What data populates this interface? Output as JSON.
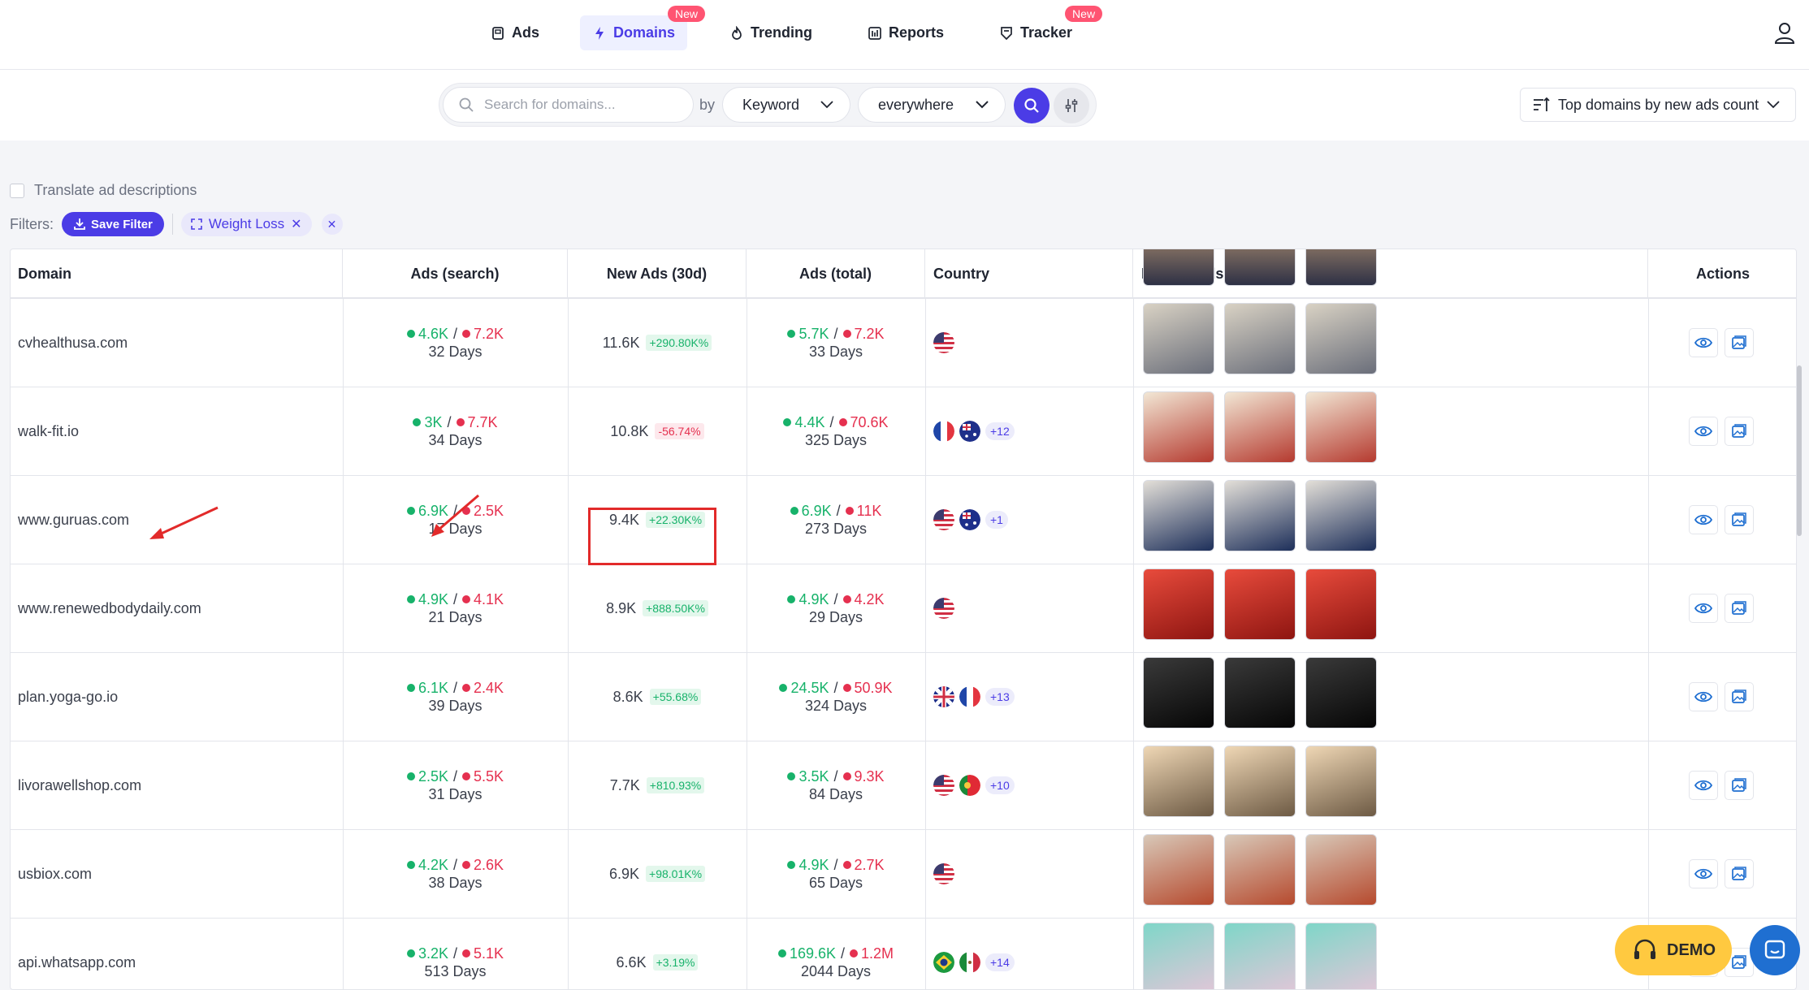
{
  "nav": {
    "items": [
      {
        "label": "Ads",
        "icon": "ads-icon",
        "active": false,
        "badge": ""
      },
      {
        "label": "Domains",
        "icon": "bolt-icon",
        "active": true,
        "badge": "New"
      },
      {
        "label": "Trending",
        "icon": "flame-icon",
        "active": false,
        "badge": ""
      },
      {
        "label": "Reports",
        "icon": "reports-icon",
        "active": false,
        "badge": ""
      },
      {
        "label": "Tracker",
        "icon": "tracker-icon",
        "active": false,
        "badge": "New"
      }
    ]
  },
  "search": {
    "placeholder": "Search for domains...",
    "by_label": "by",
    "field_select": "Keyword",
    "scope_select": "everywhere",
    "sort_label": "Top domains by new ads count"
  },
  "translate_label": "Translate ad descriptions",
  "filters": {
    "label": "Filters:",
    "save_label": "Save Filter",
    "chips": [
      {
        "label": "Weight Loss"
      }
    ]
  },
  "table": {
    "headers": {
      "domain": "Domain",
      "ads_search": "Ads (search)",
      "new_ads": "New Ads (30d)",
      "ads_total": "Ads (total)",
      "country": "Country",
      "newest_ads": "Newest Ads",
      "actions": "Actions"
    },
    "rows": [
      {
        "domain": "cvhealthusa.com",
        "search_active": "4.6K",
        "search_inactive": "7.2K",
        "search_days": "32 Days",
        "new_ads": "11.6K",
        "change": "+290.80K%",
        "total_active": "5.7K",
        "total_inactive": "7.2K",
        "total_days": "33 Days",
        "flags": [
          "us"
        ],
        "more": ""
      },
      {
        "domain": "walk-fit.io",
        "search_active": "3K",
        "search_inactive": "7.7K",
        "search_days": "34 Days",
        "new_ads": "10.8K",
        "change": "-56.74%",
        "total_active": "4.4K",
        "total_inactive": "70.6K",
        "total_days": "325 Days",
        "flags": [
          "fr",
          "au"
        ],
        "more": "+12"
      },
      {
        "domain": "www.guruas.com",
        "search_active": "6.9K",
        "search_inactive": "2.5K",
        "search_days": "17 Days",
        "new_ads": "9.4K",
        "change": "+22.30K%",
        "total_active": "6.9K",
        "total_inactive": "11K",
        "total_days": "273 Days",
        "flags": [
          "us",
          "au"
        ],
        "more": "+1"
      },
      {
        "domain": "www.renewedbodydaily.com",
        "search_active": "4.9K",
        "search_inactive": "4.1K",
        "search_days": "21 Days",
        "new_ads": "8.9K",
        "change": "+888.50K%",
        "total_active": "4.9K",
        "total_inactive": "4.2K",
        "total_days": "29 Days",
        "flags": [
          "us"
        ],
        "more": ""
      },
      {
        "domain": "plan.yoga-go.io",
        "search_active": "6.1K",
        "search_inactive": "2.4K",
        "search_days": "39 Days",
        "new_ads": "8.6K",
        "change": "+55.68%",
        "total_active": "24.5K",
        "total_inactive": "50.9K",
        "total_days": "324 Days",
        "flags": [
          "gb",
          "fr"
        ],
        "more": "+13"
      },
      {
        "domain": "livorawellshop.com",
        "search_active": "2.5K",
        "search_inactive": "5.5K",
        "search_days": "31 Days",
        "new_ads": "7.7K",
        "change": "+810.93%",
        "total_active": "3.5K",
        "total_inactive": "9.3K",
        "total_days": "84 Days",
        "flags": [
          "us",
          "pt"
        ],
        "more": "+10"
      },
      {
        "domain": "usbiox.com",
        "search_active": "4.2K",
        "search_inactive": "2.6K",
        "search_days": "38 Days",
        "new_ads": "6.9K",
        "change": "+98.01K%",
        "total_active": "4.9K",
        "total_inactive": "2.7K",
        "total_days": "65 Days",
        "flags": [
          "us"
        ],
        "more": ""
      },
      {
        "domain": "api.whatsapp.com",
        "search_active": "3.2K",
        "search_inactive": "5.1K",
        "search_days": "513 Days",
        "new_ads": "6.6K",
        "change": "+3.19%",
        "total_active": "169.6K",
        "total_inactive": "1.2M",
        "total_days": "2044 Days",
        "flags": [
          "br",
          "mx"
        ],
        "more": "+14"
      }
    ]
  },
  "demo_label": "DEMO",
  "colors": {
    "accent": "#4b3ce6",
    "positive": "#17b26a",
    "negative": "#e5304f",
    "badge": "#ff5472",
    "demo": "#ffc940"
  }
}
